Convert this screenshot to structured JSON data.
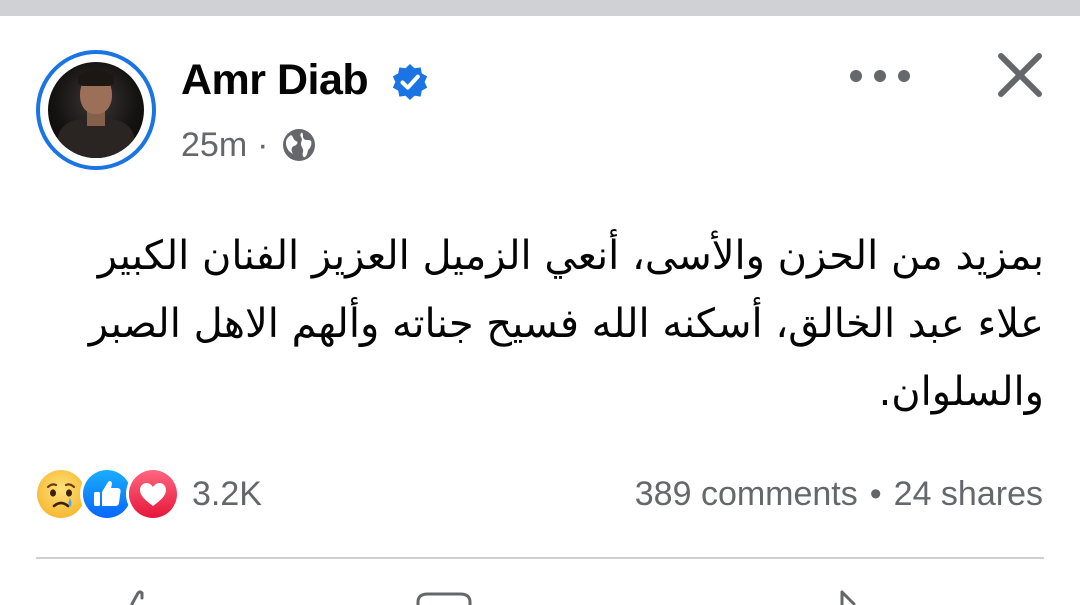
{
  "post": {
    "author": "Amr Diab",
    "time": "25m",
    "separator": "·",
    "text": "بمزيد من الحزن والأسى، أنعي الزميل العزيز الفنان الكبير علاء عبد الخالق، أسكنه الله فسيح جناته وألهم الاهل الصبر والسلوان.",
    "audience_icon": "globe-icon",
    "verified_icon": "verified-badge-icon"
  },
  "engagement": {
    "reactions": [
      "sad-reaction-icon",
      "like-reaction-icon",
      "love-reaction-icon"
    ],
    "reaction_count": "3.2K",
    "comments": "389 comments",
    "dot": "•",
    "shares": "24 shares"
  },
  "colors": {
    "accent": "#1b74e4",
    "text": "#050505",
    "secondary": "#65676b",
    "divider": "#ced0d4"
  }
}
